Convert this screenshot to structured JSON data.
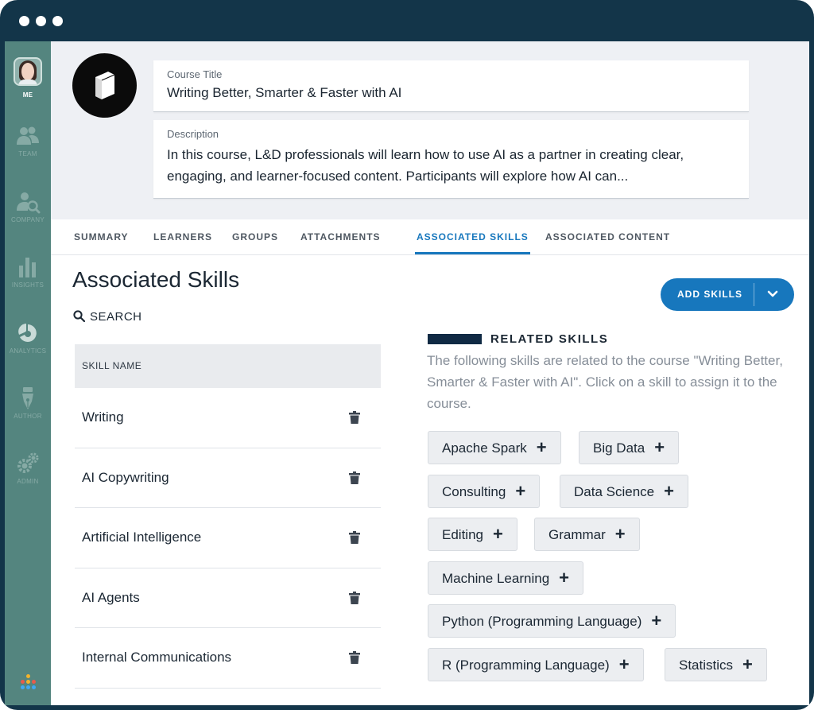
{
  "sidebar": {
    "items": [
      {
        "label": "ME",
        "icon": "user-avatar"
      },
      {
        "label": "TEAM",
        "icon": "team-icon"
      },
      {
        "label": "COMPANY",
        "icon": "company-search-icon"
      },
      {
        "label": "INSIGHTS",
        "icon": "bar-chart-icon"
      },
      {
        "label": "ANALYTICS",
        "icon": "pie-chart-icon"
      },
      {
        "label": "AUTHOR",
        "icon": "pen-nib-icon"
      },
      {
        "label": "ADMIN",
        "icon": "gears-icon"
      }
    ],
    "active": "ME"
  },
  "course": {
    "title_label": "Course Title",
    "title": "Writing Better, Smarter & Faster with AI",
    "description_label": "Description",
    "description_line1": "In this course, L&D professionals will learn how to use AI as a partner in creating clear,",
    "description_line2": "engaging, and learner-focused content. Participants will explore how AI can..."
  },
  "tabs": [
    {
      "label": "SUMMARY"
    },
    {
      "label": "LEARNERS"
    },
    {
      "label": "GROUPS"
    },
    {
      "label": "ATTACHMENTS"
    },
    {
      "label": "ASSOCIATED SKILLS"
    },
    {
      "label": "ASSOCIATED CONTENT"
    }
  ],
  "active_tab": "ASSOCIATED SKILLS",
  "skills": {
    "page_title": "Associated Skills",
    "search_label": "SEARCH",
    "column_header": "SKILL NAME",
    "rows": [
      {
        "name": "Writing"
      },
      {
        "name": "AI Copywriting"
      },
      {
        "name": "Artificial Intelligence"
      },
      {
        "name": "AI Agents"
      },
      {
        "name": "Internal Communications"
      }
    ],
    "add_button": "ADD SKILLS"
  },
  "related": {
    "title": "RELATED SKILLS",
    "description": "The following skills are related to the course \"Writing Better, Smarter & Faster with AI\". Click on a skill to assign it to the course.",
    "chips": [
      {
        "label": "Apache Spark"
      },
      {
        "label": "Big Data"
      },
      {
        "label": "Consulting"
      },
      {
        "label": "Data Science"
      },
      {
        "label": "Editing"
      },
      {
        "label": "Grammar"
      },
      {
        "label": "Machine Learning"
      },
      {
        "label": "Python (Programming Language)"
      },
      {
        "label": "R (Programming Language)"
      },
      {
        "label": "Statistics"
      }
    ],
    "chip_action": "+"
  },
  "colors": {
    "frame": "#133549",
    "sidebar": "#54857f",
    "accent": "#1777bd",
    "related_bar": "#102a44"
  }
}
